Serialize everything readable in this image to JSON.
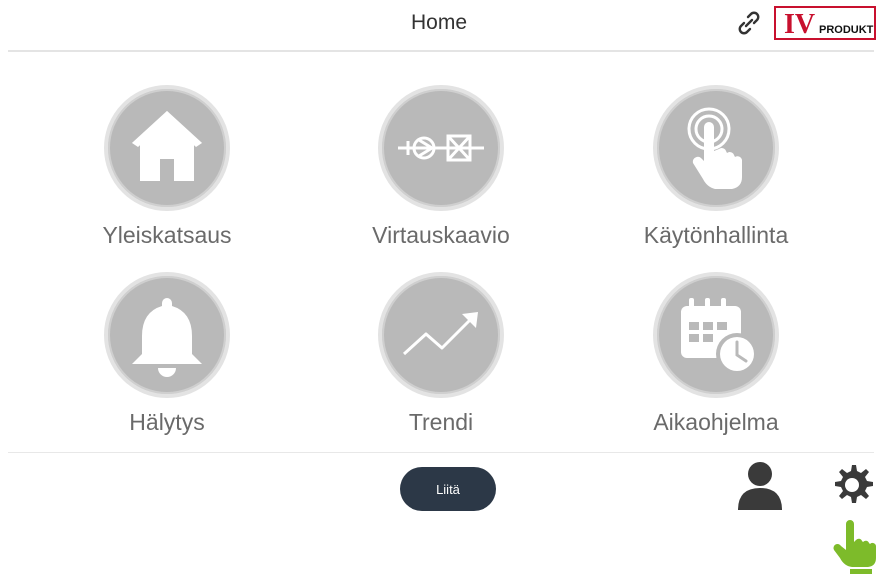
{
  "header": {
    "title": "Home",
    "logo_text_main": "IV",
    "logo_text_sub": "PRODUKT"
  },
  "tiles": [
    {
      "label": "Yleiskatsaus",
      "icon": "home-icon"
    },
    {
      "label": "Virtauskaavio",
      "icon": "flow-diagram-icon"
    },
    {
      "label": "Käytönhallinta",
      "icon": "touch-hand-icon"
    },
    {
      "label": "Hälytys",
      "icon": "bell-icon"
    },
    {
      "label": "Trendi",
      "icon": "trend-arrow-icon"
    },
    {
      "label": "Aikaohjelma",
      "icon": "calendar-clock-icon"
    }
  ],
  "footer": {
    "connect_label": "Liitä"
  },
  "colors": {
    "circle": "#b9b9b9",
    "button_bg": "#2c3847",
    "icon_dark": "#333333",
    "pointer_green": "#7dbb2a",
    "logo_red": "#c8102e"
  }
}
